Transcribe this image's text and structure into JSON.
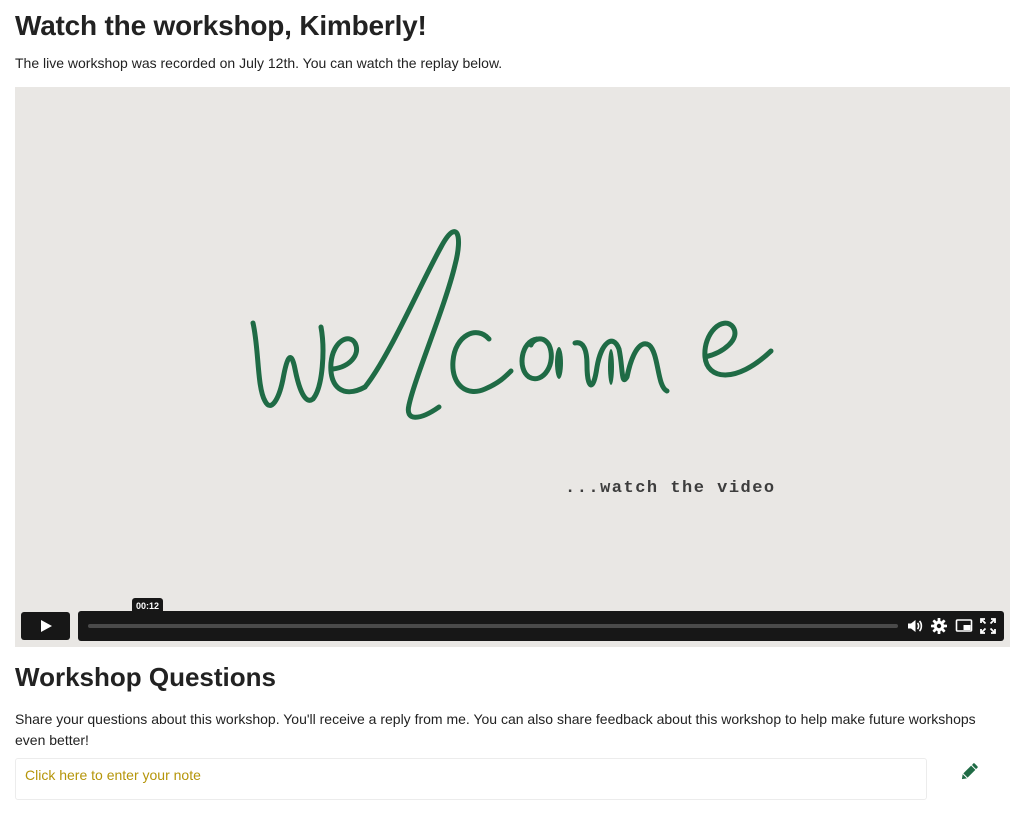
{
  "page": {
    "title": "Watch the workshop, Kimberly!",
    "subtitle": "The live workshop was recorded on July 12th. You can watch the replay below."
  },
  "video": {
    "poster_text": "welcome",
    "tagline": "...watch the video",
    "current_time": "00:12",
    "progress_fraction": 0.0,
    "icons": [
      "play-icon",
      "volume-icon",
      "settings-icon",
      "picture-in-picture-icon",
      "fullscreen-icon"
    ]
  },
  "questions": {
    "heading": "Workshop Questions",
    "description": "Share your questions about this workshop. You'll receive a reply from me. You can also share feedback about this workshop to help make future workshops even better!",
    "note_placeholder": "Click here to enter your note",
    "edit_icon": "pencil-icon"
  },
  "colors": {
    "script_green": "#1f6b45",
    "placeholder_gold": "#b5950a",
    "player_dark": "#171717",
    "video_background": "#e9e7e4"
  }
}
